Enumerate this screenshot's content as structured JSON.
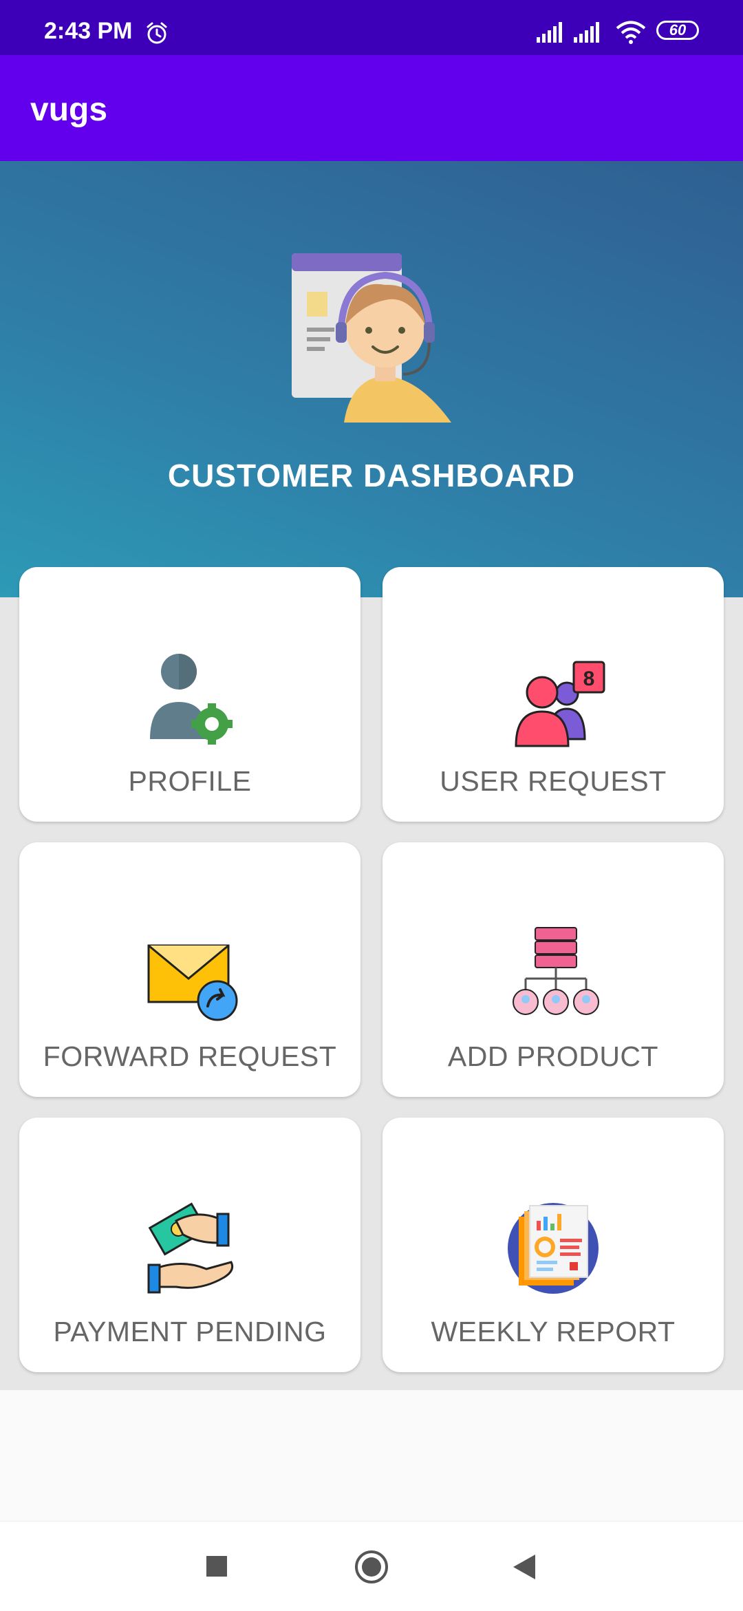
{
  "status_bar": {
    "time": "2:43 PM",
    "battery": "60",
    "icons": [
      "alarm-icon",
      "cell-signal-icon",
      "cell-signal-icon",
      "wifi-icon",
      "battery-icon"
    ]
  },
  "app_bar": {
    "title": "vugs"
  },
  "hero": {
    "title": "CUSTOMER DASHBOARD",
    "icon": "customer-support-icon"
  },
  "cards": [
    {
      "label": "PROFILE",
      "icon": "user-settings-icon"
    },
    {
      "label": "USER REQUEST",
      "icon": "users-notification-icon"
    },
    {
      "label": "FORWARD REQUEST",
      "icon": "forward-mail-icon"
    },
    {
      "label": "ADD PRODUCT",
      "icon": "server-network-icon"
    },
    {
      "label": "PAYMENT PENDING",
      "icon": "payment-hands-icon"
    },
    {
      "label": "WEEKLY REPORT",
      "icon": "report-icon"
    }
  ],
  "user_request_badge": "8",
  "colors": {
    "status_bar": "#3d00b8",
    "app_bar": "#6200ee",
    "hero_start": "#2d9ab6",
    "hero_end": "#2f5f92"
  }
}
